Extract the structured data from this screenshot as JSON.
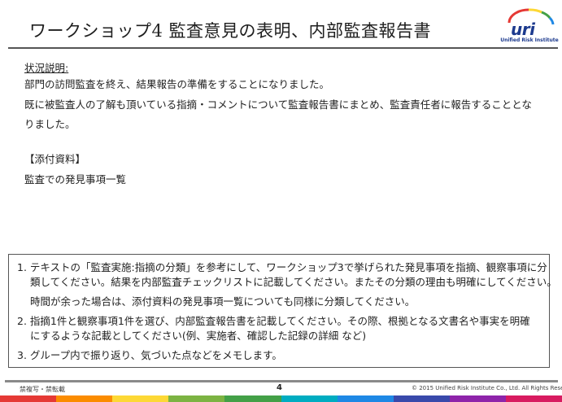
{
  "header": {
    "title": "ワークショップ4  監査意見の表明、内部監査報告書",
    "logo_text": "uri",
    "logo_subtext": "Unified Risk Institute"
  },
  "situation": {
    "heading": "状況説明:",
    "lines": [
      "部門の訪問監査を終え、結果報告の準備をすることになりました。",
      "既に被監査人の了解も頂いている指摘・コメントについて監査報告書にまとめ、監査責任者に報告することとな",
      "りました。"
    ]
  },
  "attachments": {
    "heading": "【添付資料】",
    "item": "監査での発見事項一覧"
  },
  "instructions": {
    "lines": [
      "1. テキストの「監査実施:指摘の分類」を参考にして、ワークショップ3で挙げられた発見事項を指摘、観察事項に分",
      "類してください。結果を内部監査チェックリストに記載してください。またその分類の理由も明確にしてください。",
      "時間が余った場合は、添付資料の発見事項一覧についても同様に分類してください。",
      "2. 指摘1件と観察事項1件を選び、内部監査報告書を記載してください。その際、根拠となる文書名や事実を明確",
      "にするような記載としてください(例、実施者、確認した記録の詳細  など)",
      "3. グループ内で振り返り、気づいた点などをメモします。"
    ]
  },
  "footer": {
    "classification": "禁複写・禁転載",
    "page_number": "4",
    "copyright": "© 2015 Unified Risk Institute Co., Ltd.  All Rights Reserved"
  },
  "colors": {
    "logo_blue": "#1c3a8e",
    "bar": [
      "#e53935",
      "#fb8c00",
      "#fdd835",
      "#7cb342",
      "#43a047",
      "#00acc1",
      "#1e88e5",
      "#3949ab",
      "#8e24aa",
      "#d81b60"
    ]
  }
}
